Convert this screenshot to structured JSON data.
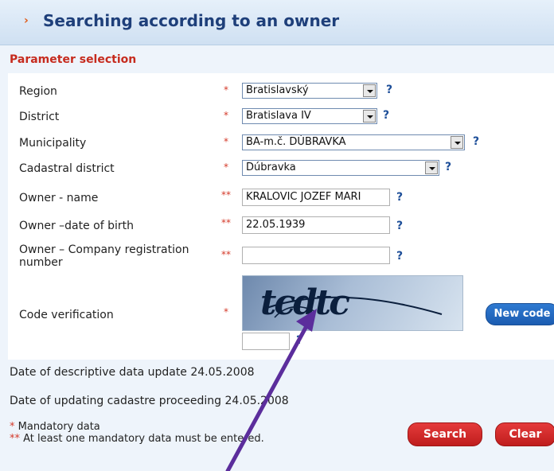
{
  "header": {
    "arrow": "›",
    "title": "Searching according to an owner"
  },
  "section": {
    "title": "Parameter selection"
  },
  "form": {
    "region": {
      "label": "Region",
      "star": "*",
      "value": "Bratislavský",
      "help": "?"
    },
    "district": {
      "label": "District",
      "star": "*",
      "value": "Bratislava IV",
      "help": "?"
    },
    "municipality": {
      "label": "Municipality",
      "star": "*",
      "value": "BA-m.č. DÚBRAVKA",
      "help": "?"
    },
    "cadastral": {
      "label": "Cadastral district",
      "star": "*",
      "value": "Dúbravka",
      "help": "?"
    },
    "owner_name": {
      "label": "Owner - name",
      "star": "**",
      "value": "KRALOVIC JOZEF MARI",
      "help": "?"
    },
    "owner_dob": {
      "label": "Owner –date of birth",
      "star": "**",
      "value": "22.05.1939",
      "help": "?"
    },
    "owner_company": {
      "label_line1": "Owner – Company registration",
      "label_line2": "number",
      "star": "**",
      "value": "",
      "help": "?"
    },
    "code": {
      "label": "Code verification",
      "star": "*",
      "captcha_text": "tcdtc",
      "new_code_label": "New code",
      "input_value": "",
      "help": "?"
    }
  },
  "info": {
    "descriptive_update": "Date of descriptive data update 24.05.2008",
    "proceeding_update": "Date of updating cadastre proceeding 24.05.2008"
  },
  "legend": {
    "mandatory_star": "*",
    "mandatory_text": " Mandatory data",
    "atleast_star": "**",
    "atleast_text": " At least one mandatory data must be entered."
  },
  "buttons": {
    "search": "Search",
    "clear": "Clear"
  },
  "colors": {
    "accent_red": "#c62b1e",
    "title_blue": "#1e3f7a",
    "annotation_purple": "#5b2d9c"
  }
}
